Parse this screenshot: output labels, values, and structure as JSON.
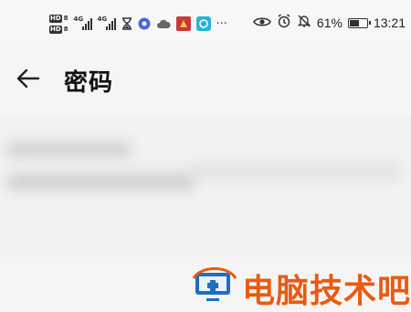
{
  "status_bar": {
    "sim1_badge": "HD",
    "sim1_num": "8",
    "sim2_badge": "HD",
    "sim2_num": "8",
    "signal1_label": "4G",
    "signal2_label": "4G",
    "more_indicator": "···",
    "battery_percent": "61%",
    "battery_level": 0.61,
    "time": "13:21",
    "icons": [
      "hourglass-icon",
      "music-app-icon",
      "cloud-icon",
      "red-app-icon",
      "blue-app-icon",
      "eye-comfort-icon",
      "alarm-icon",
      "mute-bell-icon",
      "battery-icon"
    ]
  },
  "header": {
    "back_icon": "back-arrow-icon",
    "title": "密码"
  },
  "watermark": {
    "text": "电脑技术吧",
    "color": "#ea5a12"
  }
}
